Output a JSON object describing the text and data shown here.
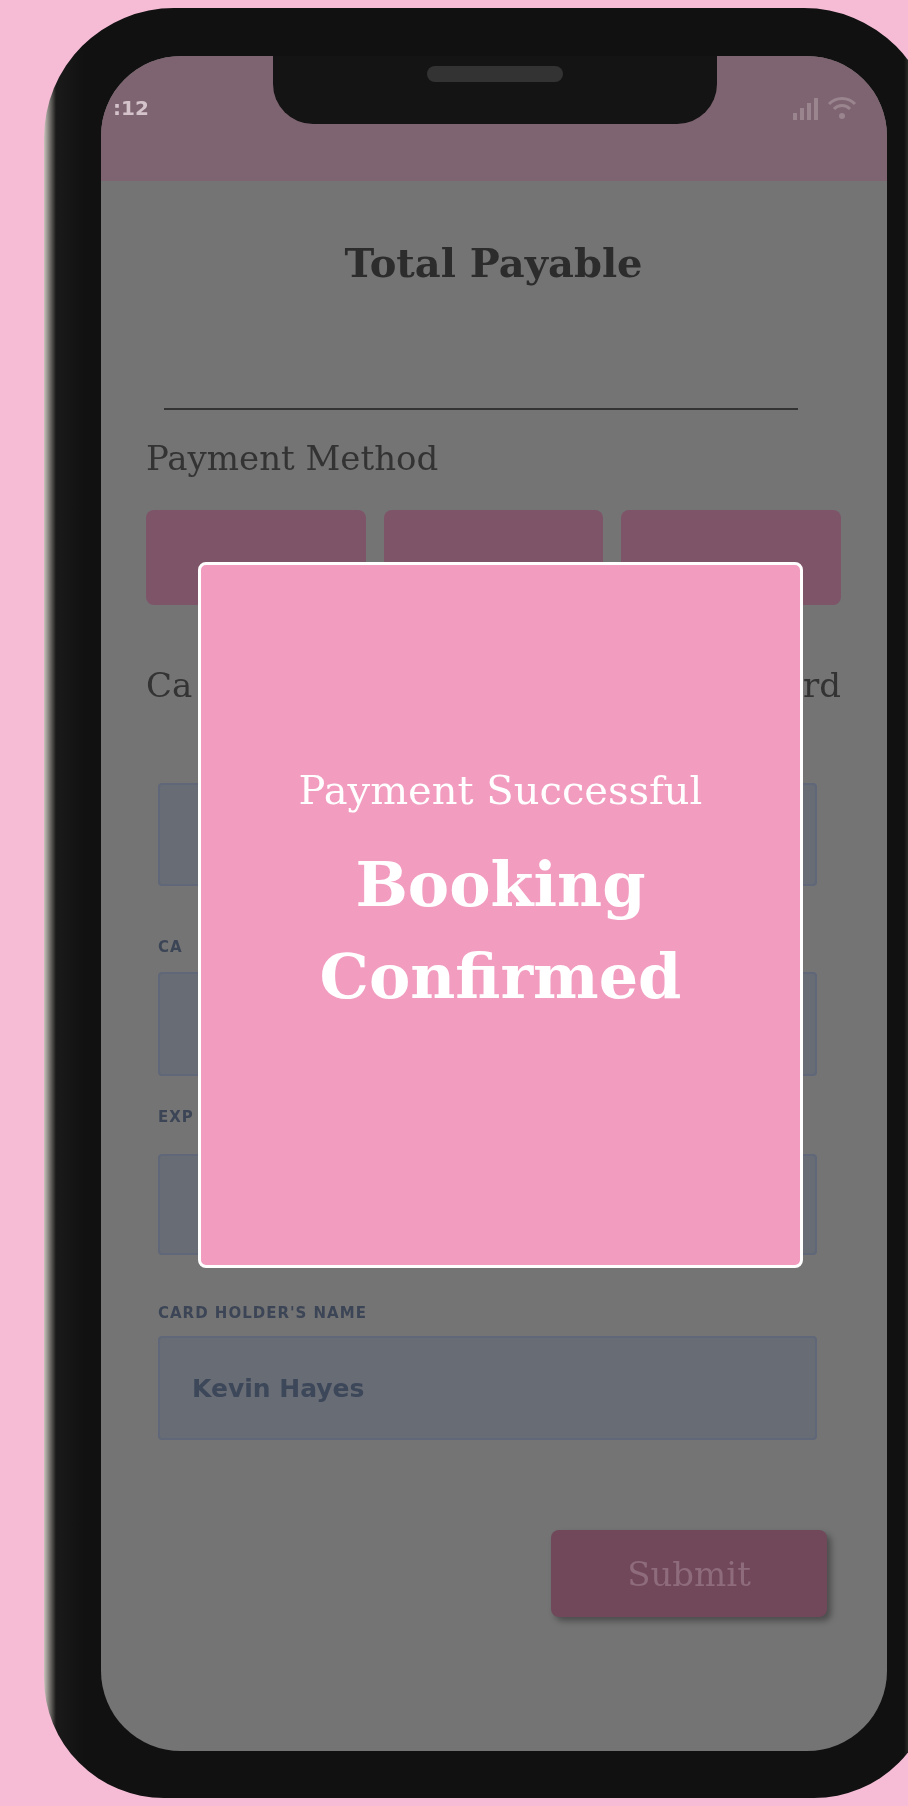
{
  "status_bar": {
    "time": ":12"
  },
  "title": "Total Payable",
  "section_label": "Payment Method",
  "payment_tabs": [
    {
      "selected": false
    },
    {
      "selected": false
    },
    {
      "selected": false
    }
  ],
  "card_row": {
    "left_text": "Ca",
    "right_text": "rd"
  },
  "fields": [
    {
      "kind": "text_input"
    },
    {
      "kind": "text_input",
      "label": "CA"
    },
    {
      "kind": "text_input",
      "label": "EXP"
    },
    {
      "kind": "text_input",
      "label": "CARD HOLDER'S NAME",
      "value": "Kevin Hayes"
    }
  ],
  "submit": "Submit",
  "modal": {
    "subtitle": "Payment Successful",
    "title": "Booking Confirmed"
  }
}
